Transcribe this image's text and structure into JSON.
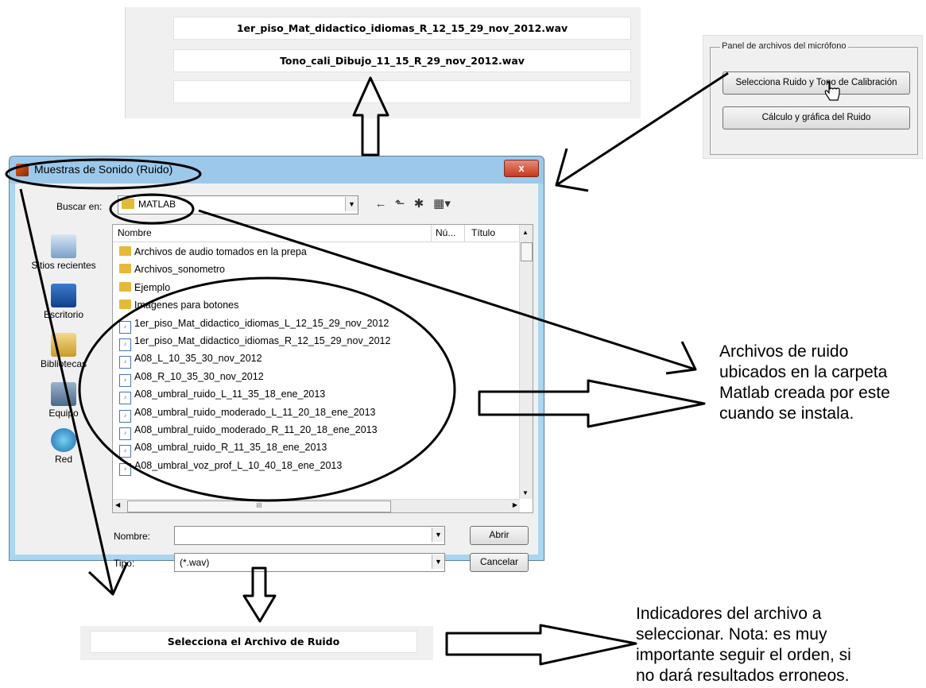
{
  "top_panel": {
    "files": [
      "1er_piso_Mat_didactico_idiomas_R_12_15_29_nov_2012.wav",
      "Tono_cali_Dibujo_11_15_R_29_nov_2012.wav",
      ""
    ]
  },
  "mic_panel": {
    "title": "Panel de archivos del micrófono",
    "select_button": "Selecciona Ruido y Tono de Calibración",
    "calc_button": "Cálculo y gráfica del Ruido"
  },
  "dialog": {
    "title": "Muestras de Sonido (Ruido)",
    "close_label": "x",
    "look_in_label": "Buscar en:",
    "look_in_value": "MATLAB",
    "places": [
      "Sitios recientes",
      "Escritorio",
      "Bibliotecas",
      "Equipo",
      "Red"
    ],
    "columns": [
      "Nombre",
      "Nú...",
      "Título"
    ],
    "items": [
      {
        "type": "folder",
        "name": "Archivos de audio tomados en la prepa"
      },
      {
        "type": "folder",
        "name": "Archivos_sonometro"
      },
      {
        "type": "folder",
        "name": "Ejemplo"
      },
      {
        "type": "folder",
        "name": "Imagenes para botones"
      },
      {
        "type": "wav",
        "name": "1er_piso_Mat_didactico_idiomas_L_12_15_29_nov_2012"
      },
      {
        "type": "wav",
        "name": "1er_piso_Mat_didactico_idiomas_R_12_15_29_nov_2012"
      },
      {
        "type": "wav",
        "name": "A08_L_10_35_30_nov_2012"
      },
      {
        "type": "wav",
        "name": "A08_R_10_35_30_nov_2012"
      },
      {
        "type": "wav",
        "name": "A08_umbral_ruido_L_11_35_18_ene_2013"
      },
      {
        "type": "wav",
        "name": "A08_umbral_ruido_moderado_L_11_20_18_ene_2013"
      },
      {
        "type": "wav",
        "name": "A08_umbral_ruido_moderado_R_11_20_18_ene_2013"
      },
      {
        "type": "wav",
        "name": "A08_umbral_ruido_R_11_35_18_ene_2013"
      },
      {
        "type": "wav",
        "name": "A08_umbral_voz_prof_L_10_40_18_ene_2013"
      }
    ],
    "name_label": "Nombre:",
    "name_value": "",
    "type_label": "Tipo:",
    "type_value": "(*.wav)",
    "open_button": "Abrir",
    "cancel_button": "Cancelar"
  },
  "bottom_panel": {
    "indicator": "Selecciona el Archivo de Ruido"
  },
  "annotations": {
    "note_files": [
      "Archivos de ruido",
      "ubicados en la carpeta",
      "Matlab creada por este",
      "cuando se instala."
    ],
    "note_order": [
      "Indicadores del archivo a",
      "seleccionar. Nota: es muy",
      "importante seguir el orden, si",
      "no dará resultados erroneos."
    ]
  },
  "colors": {
    "dialog_frame": "#a9d6f0",
    "close_button": "#c5391d",
    "folder": "#e5b93a"
  }
}
